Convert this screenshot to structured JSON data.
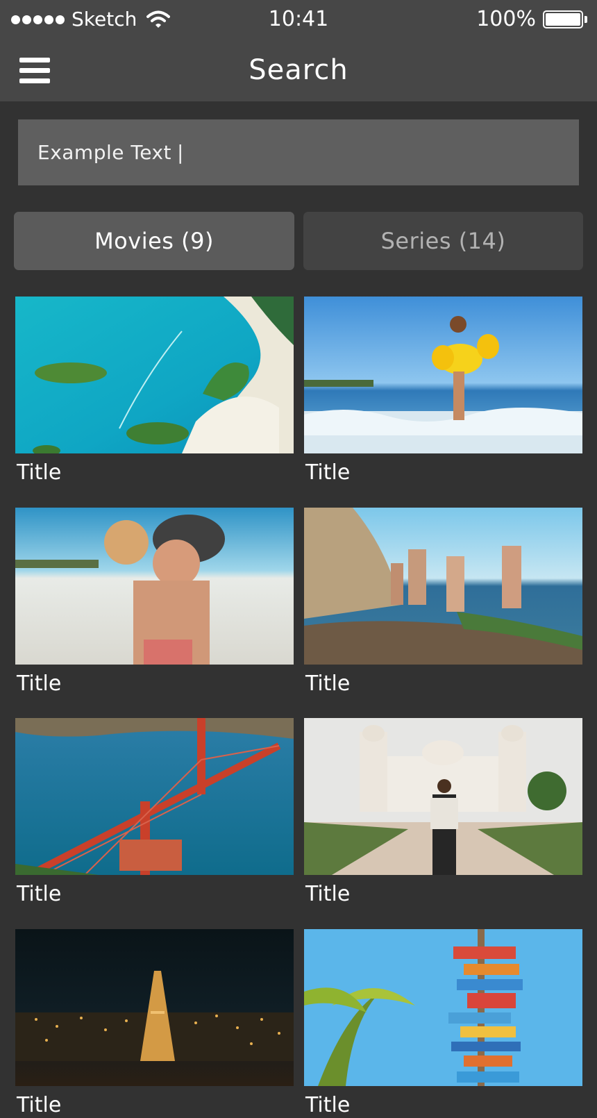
{
  "status_bar": {
    "carrier": "Sketch",
    "time": "10:41",
    "battery": "100%",
    "battery_level": 1.0,
    "icons": [
      "signal-dots-icon",
      "wifi-icon",
      "battery-icon"
    ]
  },
  "nav": {
    "title": "Search",
    "menu_icon": "hamburger-menu-icon"
  },
  "search": {
    "value": "Example Text"
  },
  "tabs": [
    {
      "label": "Movies (9)",
      "active": true
    },
    {
      "label": "Series (14)",
      "active": false
    }
  ],
  "results": [
    {
      "title": "Title",
      "image": "aerial tropical islands and turquoise sea"
    },
    {
      "title": "Title",
      "image": "girl with inflatable duck float splashing in waves"
    },
    {
      "title": "Title",
      "image": "couple piggyback on beach wearing sunglasses"
    },
    {
      "title": "Title",
      "image": "friends jumping on rocky coastline"
    },
    {
      "title": "Title",
      "image": "aerial Golden Gate Bridge over blue bay"
    },
    {
      "title": "Title",
      "image": "traveler with backpack in front of white marble tomb"
    },
    {
      "title": "Title",
      "image": "Eiffel Tower and Paris city lights at night"
    },
    {
      "title": "Title",
      "image": "colorful destination signpost with palm tree"
    }
  ],
  "colors": {
    "background": "#323232",
    "bars": "#474747",
    "search_field": "#5f5f5f",
    "tab_active": "#5b5b5b",
    "tab_inactive": "#434343",
    "tab_inactive_text": "#b2b2b2"
  }
}
